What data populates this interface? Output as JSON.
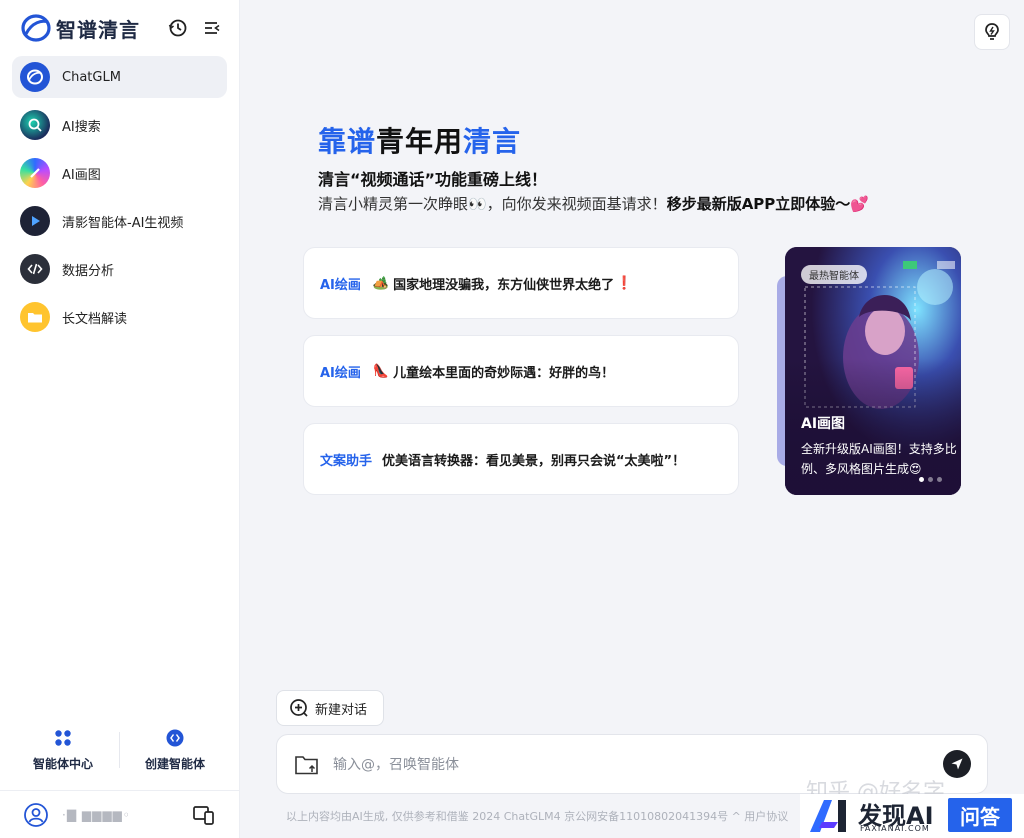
{
  "app": {
    "brand_name": "智谱清言"
  },
  "sidebar": {
    "items": [
      {
        "label": "ChatGLM",
        "icon": "chatglm-logo-icon",
        "active": true
      },
      {
        "label": "AI搜索",
        "icon": "ai-search-icon"
      },
      {
        "label": "AI画图",
        "icon": "ai-paint-icon"
      },
      {
        "label": "清影智能体-AI生视频",
        "icon": "video-play-icon"
      },
      {
        "label": "数据分析",
        "icon": "code-icon"
      },
      {
        "label": "长文档解读",
        "icon": "folder-icon"
      }
    ],
    "agent_center_label": "智能体中心",
    "create_agent_label": "创建智能体",
    "user_name": "·▇ ▆▆▆▆◦"
  },
  "main": {
    "headline": {
      "part1": "靠谱",
      "part2": "青年用",
      "part3": "清言"
    },
    "subhead": "清言“视频通话”功能重磅上线！",
    "subline": {
      "text": "清言小精灵第一次睁眼👀，向你发来视频面基请求！",
      "bold": "移步最新版APP立即体验～",
      "emoji": "💕"
    },
    "cards": [
      {
        "tag": "AI绘画",
        "emoji": "🏕️",
        "text": "国家地理没骗我，东方仙侠世界太绝了",
        "suffix": "❗"
      },
      {
        "tag": "AI绘画",
        "emoji": "👠",
        "text": "儿童绘本里面的奇妙际遇：好胖的鸟！",
        "suffix": ""
      },
      {
        "tag": "文案助手",
        "emoji": "",
        "text": "优美语言转换器：看见美景，别再只会说“太美啦”！",
        "suffix": ""
      }
    ],
    "carousel": {
      "badge": "最热智能体",
      "title": "AI画图",
      "desc_line1": "全新升级版AI画图！支持多比",
      "desc_line2": "例、多风格图片生成😍",
      "active_dot": 0,
      "dot_count": 3
    },
    "new_chat_label": "新建对话",
    "composer_placeholder": "输入@，召唤智能体",
    "footer": "以上内容均由AI生成, 仅供参考和借鉴    2024 ChatGLM4 京公网安备11010802041394号 ^ 用户协议"
  },
  "watermark": {
    "zhihu": "知乎 @好名字",
    "brand": "发现AI",
    "sub": "FAXIANAI.COM",
    "qa": "问答"
  },
  "colors": {
    "accent": "#2563eb",
    "sidebar_active": "#eef0f5",
    "background": "#f3f4f8"
  }
}
